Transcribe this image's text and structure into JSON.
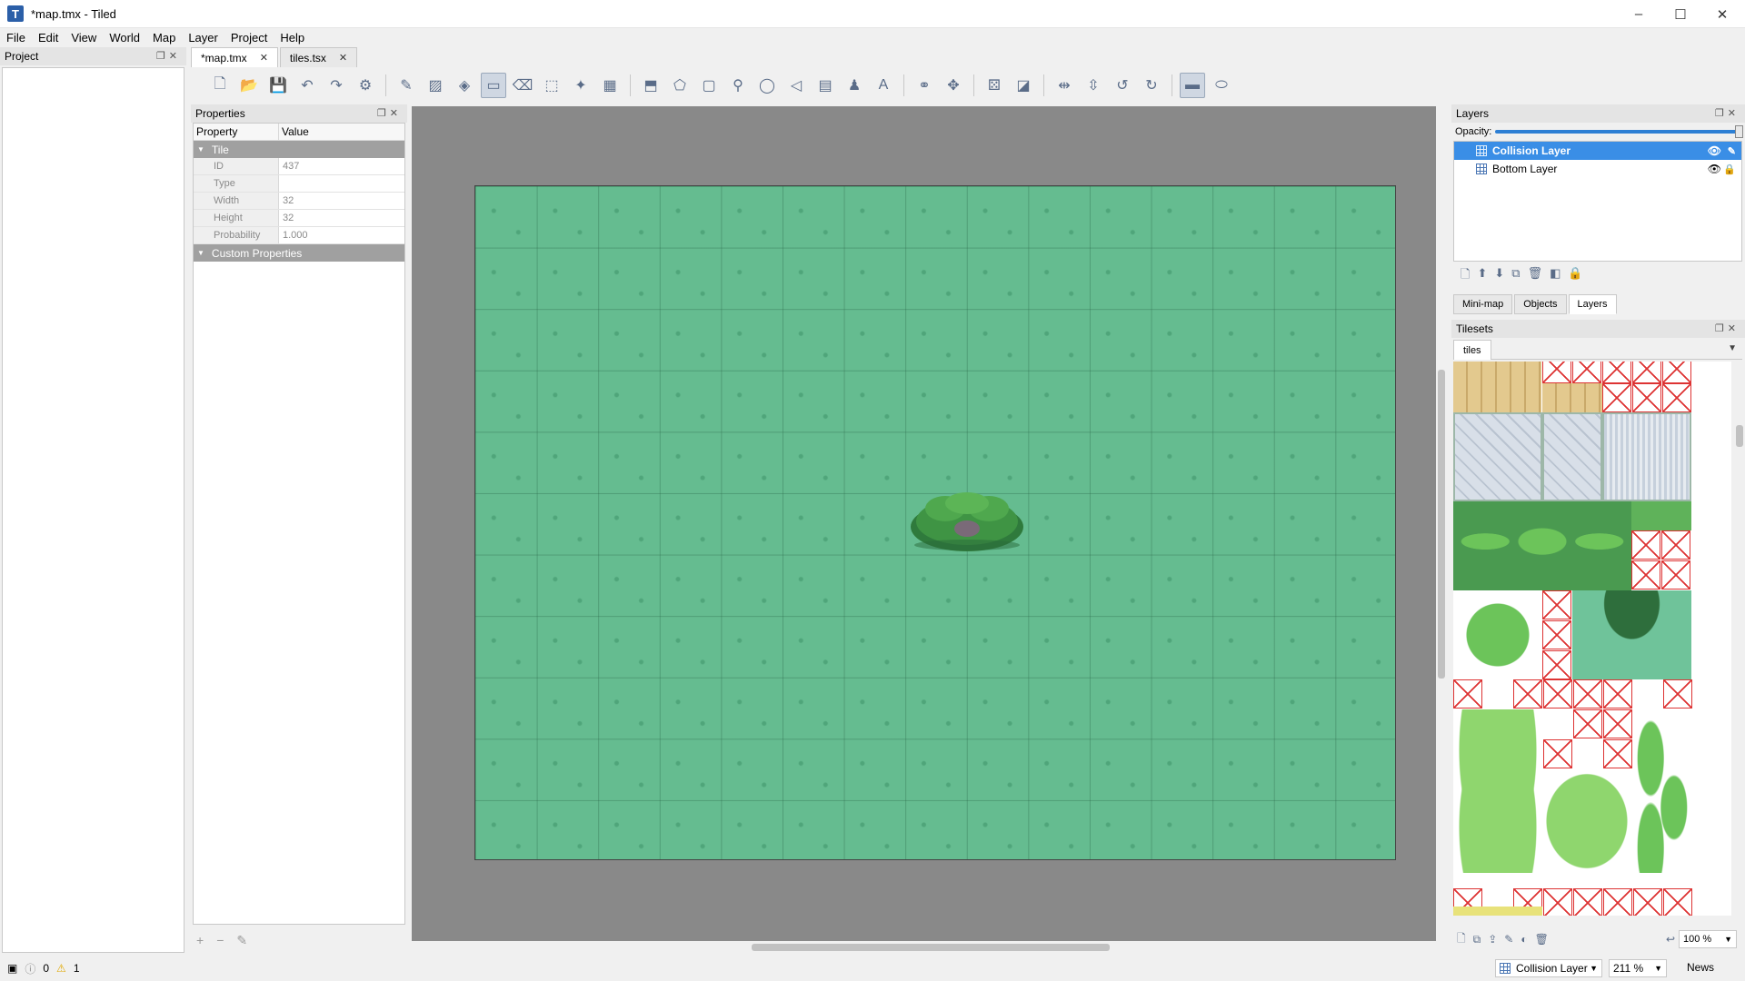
{
  "window": {
    "title": "*map.tmx - Tiled",
    "app_icon": "T",
    "controls": {
      "minimize": "–",
      "maximize": "☐",
      "close": "✕"
    }
  },
  "menu": [
    "File",
    "Edit",
    "View",
    "World",
    "Map",
    "Layer",
    "Project",
    "Help"
  ],
  "project_panel": {
    "title": "Project"
  },
  "doc_tabs": [
    {
      "label": "*map.tmx",
      "active": true
    },
    {
      "label": "tiles.tsx",
      "active": false
    }
  ],
  "properties": {
    "title": "Properties",
    "col_property": "Property",
    "col_value": "Value",
    "group_tile": "Tile",
    "rows": [
      {
        "key": "ID",
        "value": "437"
      },
      {
        "key": "Type",
        "value": ""
      },
      {
        "key": "Width",
        "value": "32"
      },
      {
        "key": "Height",
        "value": "32"
      },
      {
        "key": "Probability",
        "value": "1.000"
      }
    ],
    "group_custom": "Custom Properties"
  },
  "layers": {
    "title": "Layers",
    "opacity_label": "Opacity:",
    "opacity_value": 1.0,
    "items": [
      {
        "name": "Collision Layer",
        "selected": true
      },
      {
        "name": "Bottom Layer",
        "selected": false
      }
    ],
    "tabs": [
      {
        "label": "Mini-map",
        "active": false
      },
      {
        "label": "Objects",
        "active": false
      },
      {
        "label": "Layers",
        "active": true
      }
    ]
  },
  "tilesets": {
    "title": "Tilesets",
    "tab": "tiles",
    "zoom": "100 %"
  },
  "statusbar": {
    "errors": "0",
    "warnings": "1",
    "current_layer": "Collision Layer",
    "zoom": "211 %",
    "news": "News"
  },
  "colors": {
    "map_grass": "#65bc90",
    "selection": "#3a8ee6",
    "canvas_bg": "#898989"
  }
}
